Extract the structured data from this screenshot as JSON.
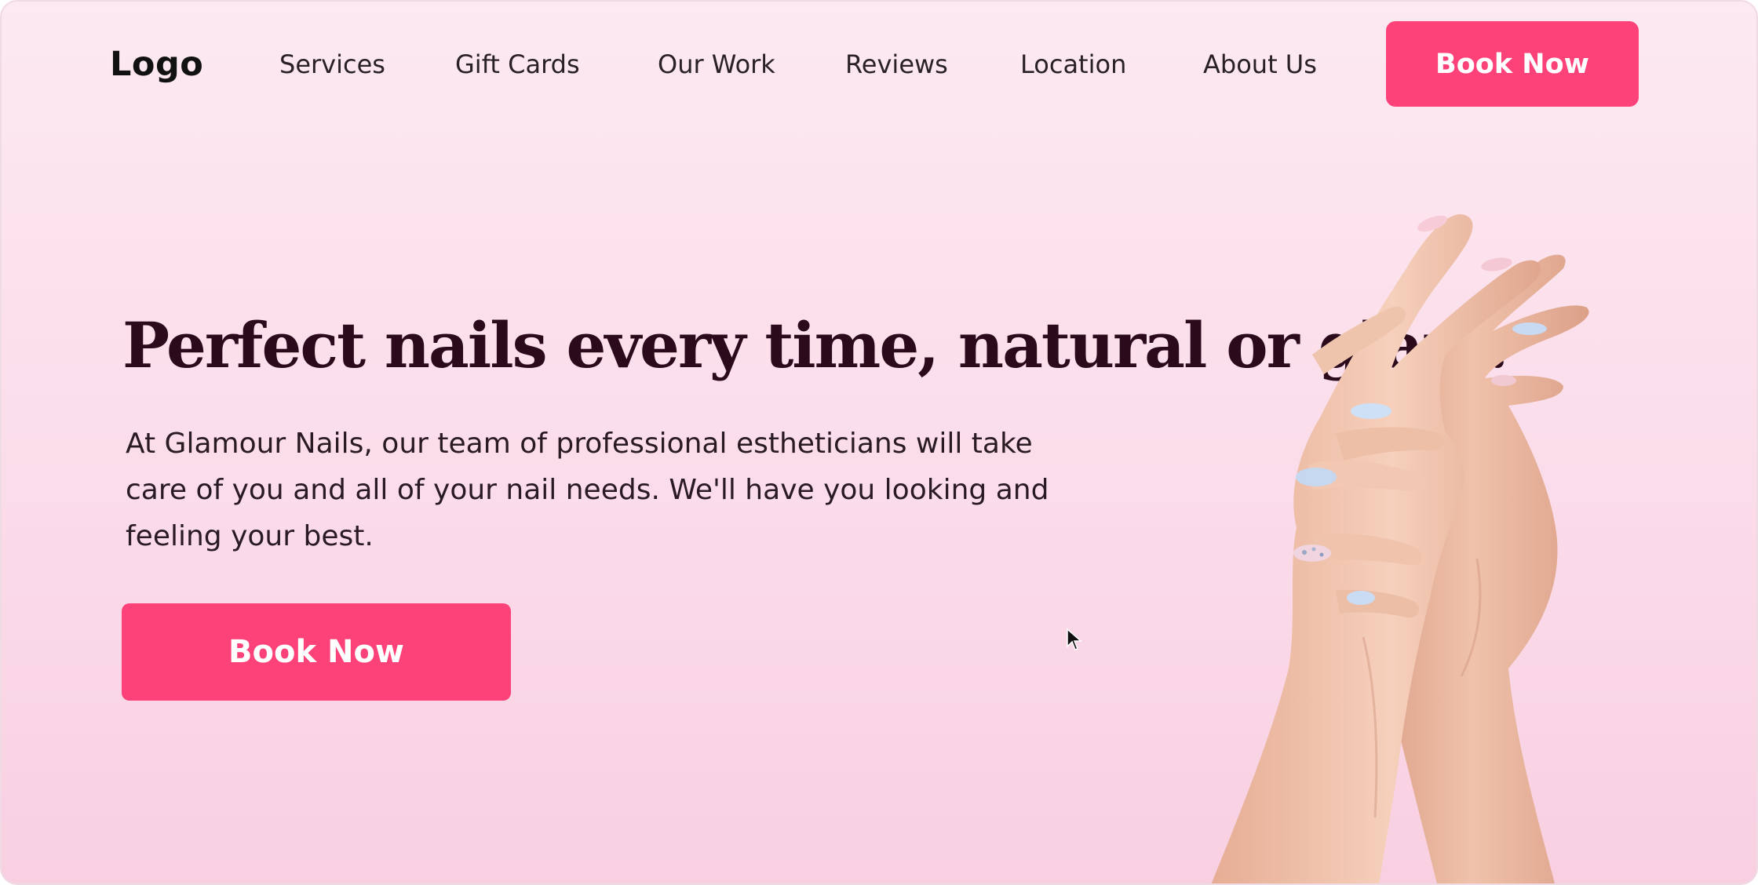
{
  "header": {
    "logo": "Logo",
    "nav": [
      {
        "label": "Services"
      },
      {
        "label": "Gift Cards"
      },
      {
        "label": "Our Work"
      },
      {
        "label": "Reviews"
      },
      {
        "label": "Location"
      },
      {
        "label": "About Us"
      }
    ],
    "cta_label": "Book Now"
  },
  "hero": {
    "title": "Perfect nails every time, natural or glam.",
    "body": "At Glamour Nails, our team of professional estheticians will take care of you and all of your nail needs. We'll have you looking and feeling your best.",
    "cta_label": "Book Now",
    "image": "hands-with-manicured-nails"
  },
  "colors": {
    "accent": "#fc4279",
    "title_text": "#2b0a1c",
    "background_top": "#fce9f1",
    "background_bottom": "#f8d0e2"
  }
}
